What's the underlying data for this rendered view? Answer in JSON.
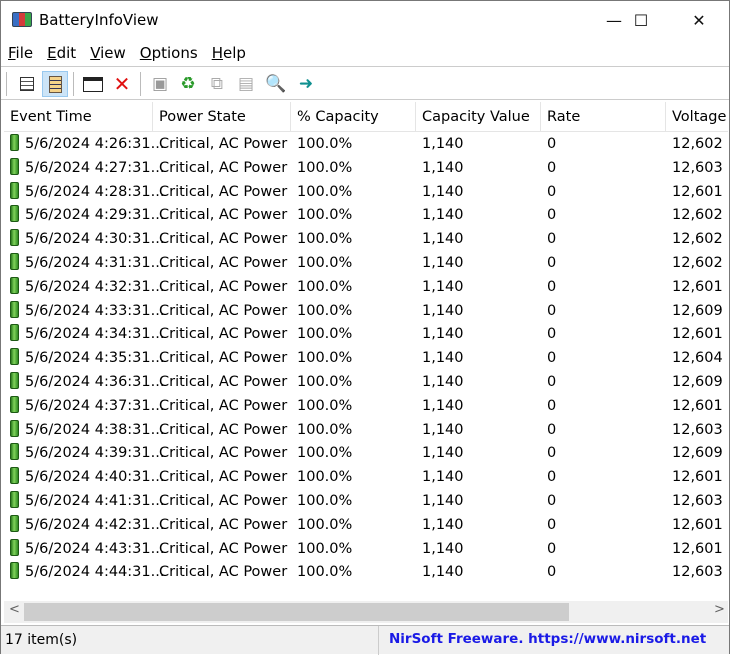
{
  "window": {
    "title": "BatteryInfoView",
    "minimize": "—",
    "maximize": "☐",
    "close": "✕"
  },
  "menu": [
    {
      "key": "F",
      "rest": "ile"
    },
    {
      "key": "E",
      "rest": "dit"
    },
    {
      "key": "V",
      "rest": "iew"
    },
    {
      "key": "O",
      "rest": "ptions"
    },
    {
      "key": "H",
      "rest": "elp"
    }
  ],
  "toolbar": {
    "icons": [
      "battery-info-icon",
      "log-view-icon",
      "html-report-icon",
      "delete-icon",
      "save-icon",
      "refresh-icon",
      "copy-icon",
      "properties-icon",
      "find-icon",
      "exit-icon"
    ]
  },
  "columns": [
    "Event Time",
    "Power State",
    "% Capacity",
    "Capacity Value",
    "Rate",
    "Voltage"
  ],
  "rows": [
    [
      "5/6/2024 4:26:31...",
      "Critical, AC Power",
      "100.0%",
      "1,140",
      "0",
      "12,602"
    ],
    [
      "5/6/2024 4:27:31...",
      "Critical, AC Power",
      "100.0%",
      "1,140",
      "0",
      "12,603"
    ],
    [
      "5/6/2024 4:28:31...",
      "Critical, AC Power",
      "100.0%",
      "1,140",
      "0",
      "12,601"
    ],
    [
      "5/6/2024 4:29:31...",
      "Critical, AC Power",
      "100.0%",
      "1,140",
      "0",
      "12,602"
    ],
    [
      "5/6/2024 4:30:31...",
      "Critical, AC Power",
      "100.0%",
      "1,140",
      "0",
      "12,602"
    ],
    [
      "5/6/2024 4:31:31...",
      "Critical, AC Power",
      "100.0%",
      "1,140",
      "0",
      "12,602"
    ],
    [
      "5/6/2024 4:32:31...",
      "Critical, AC Power",
      "100.0%",
      "1,140",
      "0",
      "12,601"
    ],
    [
      "5/6/2024 4:33:31...",
      "Critical, AC Power",
      "100.0%",
      "1,140",
      "0",
      "12,609"
    ],
    [
      "5/6/2024 4:34:31...",
      "Critical, AC Power",
      "100.0%",
      "1,140",
      "0",
      "12,601"
    ],
    [
      "5/6/2024 4:35:31...",
      "Critical, AC Power",
      "100.0%",
      "1,140",
      "0",
      "12,604"
    ],
    [
      "5/6/2024 4:36:31...",
      "Critical, AC Power",
      "100.0%",
      "1,140",
      "0",
      "12,609"
    ],
    [
      "5/6/2024 4:37:31...",
      "Critical, AC Power",
      "100.0%",
      "1,140",
      "0",
      "12,601"
    ],
    [
      "5/6/2024 4:38:31...",
      "Critical, AC Power",
      "100.0%",
      "1,140",
      "0",
      "12,603"
    ],
    [
      "5/6/2024 4:39:31...",
      "Critical, AC Power",
      "100.0%",
      "1,140",
      "0",
      "12,609"
    ],
    [
      "5/6/2024 4:40:31...",
      "Critical, AC Power",
      "100.0%",
      "1,140",
      "0",
      "12,601"
    ],
    [
      "5/6/2024 4:41:31...",
      "Critical, AC Power",
      "100.0%",
      "1,140",
      "0",
      "12,603"
    ],
    [
      "5/6/2024 4:42:31...",
      "Critical, AC Power",
      "100.0%",
      "1,140",
      "0",
      "12,601"
    ],
    [
      "5/6/2024 4:43:31...",
      "Critical, AC Power",
      "100.0%",
      "1,140",
      "0",
      "12,601"
    ],
    [
      "5/6/2024 4:44:31...",
      "Critical, AC Power",
      "100.0%",
      "1,140",
      "0",
      "12,603"
    ]
  ],
  "status": {
    "count": "17 item(s)",
    "credit": "NirSoft Freeware. https://www.nirsoft.net"
  }
}
